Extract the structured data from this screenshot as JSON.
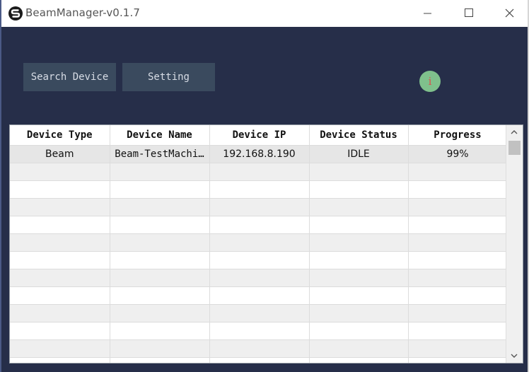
{
  "window": {
    "title": "BeamManager-v0.1.7"
  },
  "toolbar": {
    "search_label": "Search Device",
    "setting_label": "Setting",
    "info_glyph": "i"
  },
  "table": {
    "columns": [
      "Device Type",
      "Device Name",
      "Device IP",
      "Device Status",
      "Progress"
    ],
    "rows": [
      {
        "type": "Beam",
        "name": "Beam-TestMachi…",
        "ip": "192.168.8.190",
        "status": "IDLE",
        "progress": "99%"
      }
    ]
  },
  "colors": {
    "background": "#262e49",
    "button": "#3a4a5e",
    "info_badge": "#7fc08c"
  },
  "icons": {
    "app": "app-logo-icon",
    "minimize": "minimize-icon",
    "maximize": "maximize-icon",
    "close": "close-icon",
    "info": "info-icon",
    "scroll_up": "chevron-up-icon",
    "scroll_down": "chevron-down-icon"
  }
}
